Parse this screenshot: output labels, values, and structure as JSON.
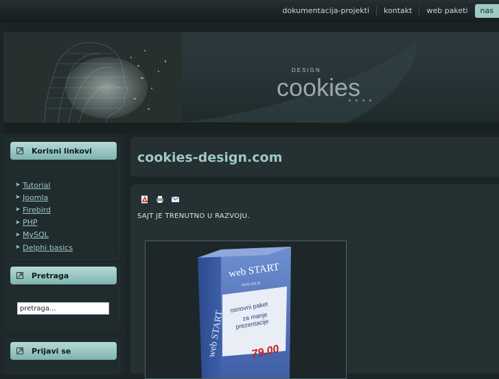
{
  "topnav": {
    "items": [
      "dokumentacija-projekti",
      "kontakt",
      "web paketi"
    ],
    "active": "nas"
  },
  "banner": {
    "logo_small": "DESIGN",
    "logo_main": "cookies"
  },
  "sidebar": {
    "links_title": "Korisni linkovi",
    "links": [
      "Tutorial",
      "Joomla",
      "Firebird",
      "PHP",
      "MySQL",
      "Delphi basics"
    ],
    "search_title": "Pretraga",
    "search_value": "pretraga...",
    "login_title": "Prijavi se"
  },
  "main": {
    "title": "cookies-design.com",
    "message": "SAJT JE TRENUTNO U RAZVOJU.",
    "icons": [
      "pdf-icon",
      "print-icon",
      "email-icon"
    ],
    "product": {
      "front_title": "web START",
      "front_sub": "html css js",
      "desc_line1": "osnovni paket",
      "desc_line2": "za manje",
      "desc_line3": "prezentacije",
      "side_text": "web START",
      "price": "79.00"
    }
  },
  "colors": {
    "accent": "#9ec9c6",
    "background": "#1b2426",
    "panel": "#253032"
  }
}
